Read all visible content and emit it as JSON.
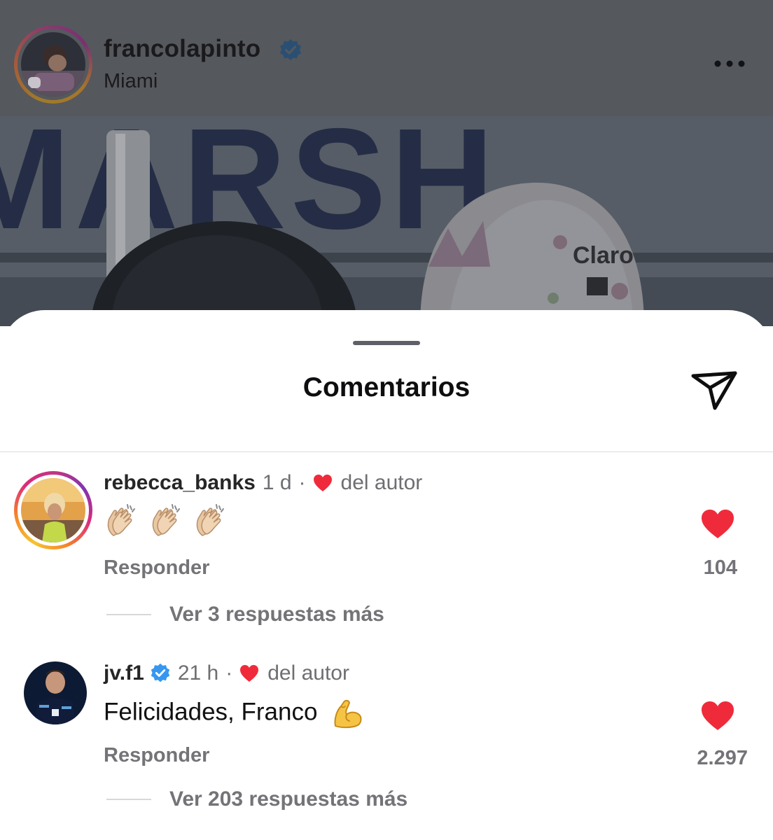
{
  "post": {
    "username": "francolapinto",
    "location": "Miami",
    "verified": true,
    "more_icon": "more-horizontal-icon",
    "image_text": {
      "sign": "MARSH",
      "cap_brand": "Claro"
    }
  },
  "sheet": {
    "title": "Comentarios",
    "share_icon": "paper-plane-icon"
  },
  "comments": [
    {
      "username": "rebecca_banks",
      "verified": false,
      "time": "1 d",
      "separator": "·",
      "liked_by_author": "del autor",
      "text": "👏🏼👏🏼👏🏼",
      "reply_label": "Responder",
      "likes": "104",
      "replies_label": "Ver 3 respuestas más"
    },
    {
      "username": "jv.f1",
      "verified": true,
      "time": "21 h",
      "separator": "·",
      "liked_by_author": "del autor",
      "text": "Felicidades, Franco",
      "emoji": "💪",
      "reply_label": "Responder",
      "likes": "2.297",
      "replies_label": "Ver 203 respuestas más"
    }
  ],
  "colors": {
    "heart": "#ef2b3b",
    "verified": "#3797f0",
    "dim_overlay": "#55585d",
    "secondary_text": "#737378"
  }
}
